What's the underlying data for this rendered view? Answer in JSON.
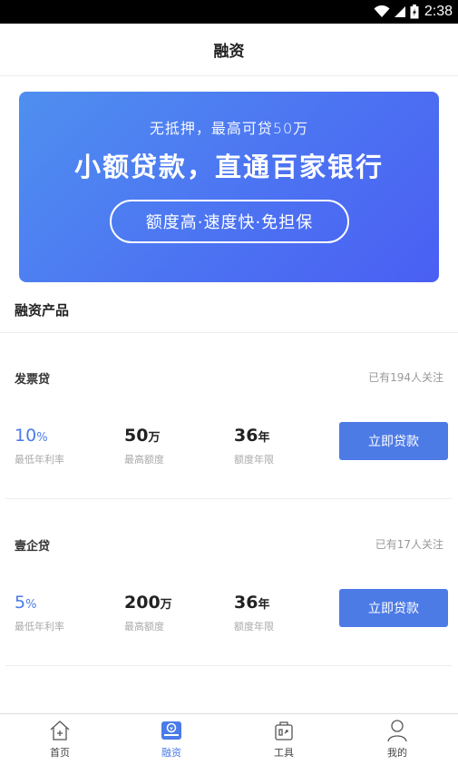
{
  "status_bar": {
    "time": "2:38"
  },
  "header": {
    "title": "融资"
  },
  "banner": {
    "subtitle": "无抵押，最高可贷50万",
    "title": "小额贷款，直通百家银行",
    "pill": "额度高·速度快·免担保"
  },
  "section": {
    "title": "融资产品"
  },
  "products": [
    {
      "name": "发票贷",
      "followers": "已有194人关注",
      "rate_value": "10",
      "rate_unit": "%",
      "rate_label": "最低年利率",
      "amount_value": "50",
      "amount_unit": "万",
      "amount_label": "最高额度",
      "term_value": "36",
      "term_unit": "年",
      "term_label": "额度年限",
      "button": "立即贷款"
    },
    {
      "name": "壹企贷",
      "followers": "已有17人关注",
      "rate_value": "5",
      "rate_unit": "%",
      "rate_label": "最低年利率",
      "amount_value": "200",
      "amount_unit": "万",
      "amount_label": "最高额度",
      "term_value": "36",
      "term_unit": "年",
      "term_label": "额度年限",
      "button": "立即贷款"
    }
  ],
  "tabbar": {
    "items": [
      {
        "label": "首页",
        "icon": "home-icon"
      },
      {
        "label": "融资",
        "icon": "finance-icon"
      },
      {
        "label": "工具",
        "icon": "tools-icon"
      },
      {
        "label": "我的",
        "icon": "user-icon"
      }
    ],
    "active_index": 1
  },
  "colors": {
    "accent": "#4d7be6",
    "banner_start": "#4f8ff0",
    "banner_end": "#4a5ff3"
  }
}
